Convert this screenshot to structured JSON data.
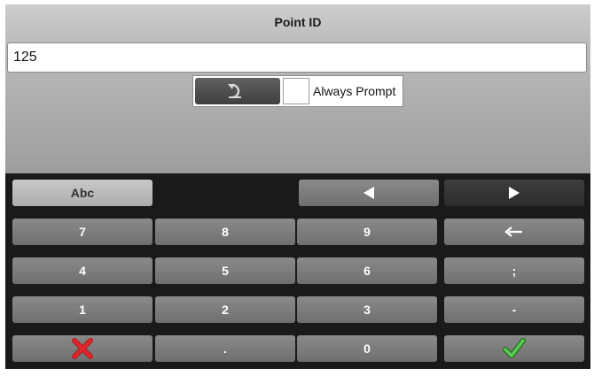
{
  "dialog": {
    "title": "Point ID",
    "value": "125",
    "undo_icon": "undo-icon",
    "always_prompt_label": "Always Prompt",
    "always_prompt_checked": false
  },
  "keyboard": {
    "mode_label": "Abc",
    "row1": [
      "7",
      "8",
      "9"
    ],
    "row2": [
      "4",
      "5",
      "6"
    ],
    "row3": [
      "1",
      "2",
      "3"
    ],
    "dot": ".",
    "zero": "0",
    "semicolon": ";",
    "dash": "-",
    "icons": {
      "left": "triangle-left-icon",
      "right": "triangle-right-icon",
      "backspace": "backspace-arrow-icon",
      "cancel": "red-x-icon",
      "ok": "green-check-icon"
    },
    "colors": {
      "cancel": "#e0262b",
      "ok": "#3fae3a"
    }
  }
}
